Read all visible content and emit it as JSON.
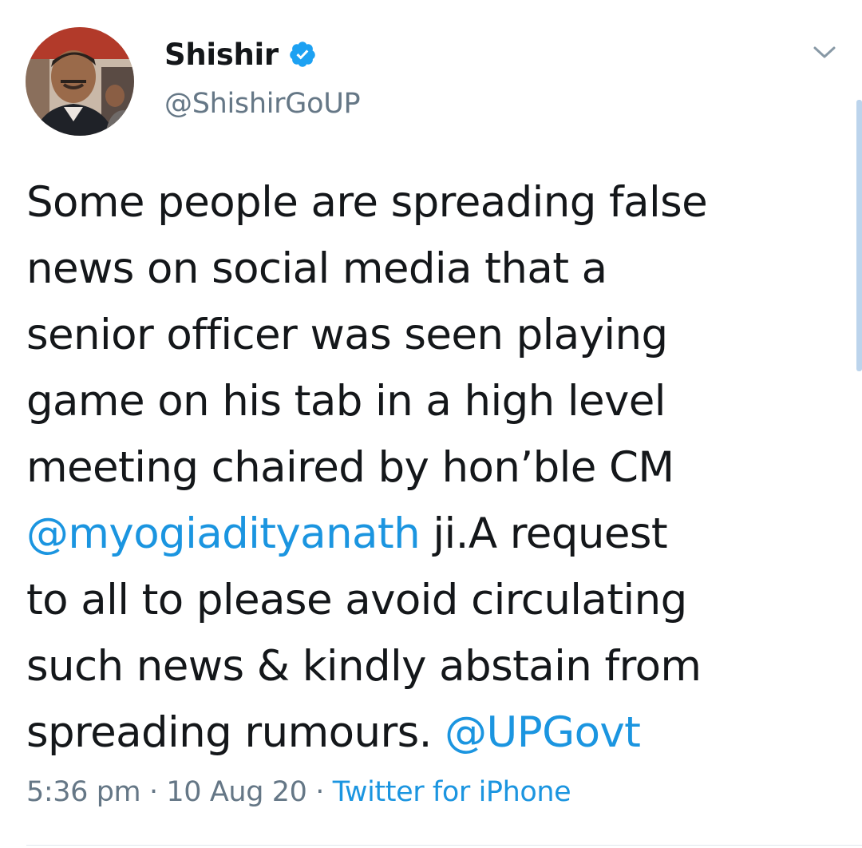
{
  "author": {
    "display_name": "Shishir",
    "handle": "@ShishirGoUP",
    "verified": true,
    "avatar_icon": "profile-photo"
  },
  "tweet": {
    "line1": "Some people are spreading false",
    "line2": "news on social media that a",
    "line3": "senior officer was seen playing",
    "line4": "game on his tab in a high level",
    "line5": "meeting chaired by hon’ble CM",
    "line6_mention": "@myogiadityanath",
    "line6_rest": " ji.A request",
    "line7": "to all to please avoid circulating",
    "line8": "such news & kindly abstain from",
    "line9_text": "spreading rumours. ",
    "line9_mention": "@UPGovt"
  },
  "meta": {
    "time": "5:36 pm",
    "sep1": " · ",
    "date": "10 Aug 20",
    "sep2": " · ",
    "source": "Twitter for iPhone"
  },
  "icons": {
    "verified": "verified-badge-icon",
    "menu": "chevron-down-icon"
  },
  "colors": {
    "link": "#1b95e0",
    "secondary_text": "#657786",
    "primary_text": "#14171a",
    "verified_badge": "#1da1f2"
  }
}
